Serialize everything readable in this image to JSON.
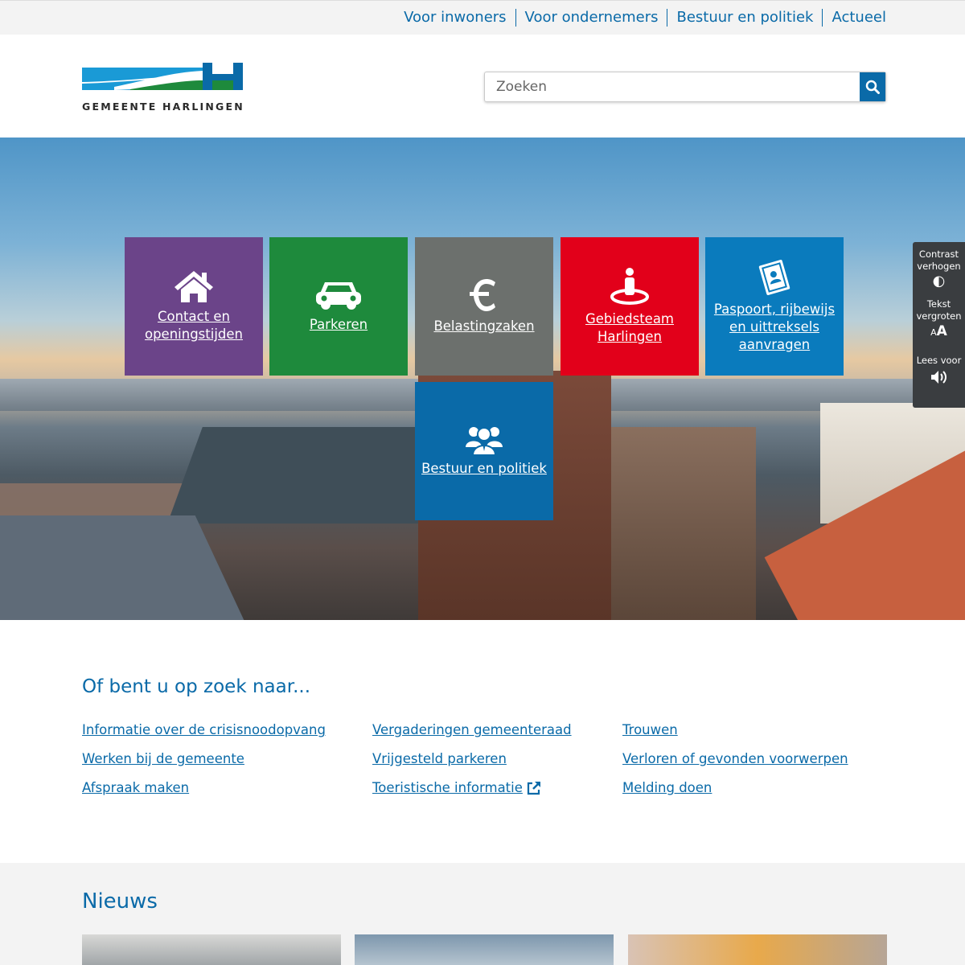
{
  "topnav": [
    "Voor inwoners",
    "Voor ondernemers",
    "Bestuur en politiek",
    "Actueel"
  ],
  "logo": {
    "text": "GEMEENTE HARLINGEN"
  },
  "search": {
    "placeholder": "Zoeken"
  },
  "colors": {
    "brand_blue": "#0a6aa8",
    "purple": "#6b4489",
    "green": "#1e8a3c",
    "grey": "#6c706d",
    "red": "#e2001a",
    "light_blue": "#0a7bbd"
  },
  "tiles": [
    {
      "label": "Contact en openingstijden",
      "icon": "home-icon"
    },
    {
      "label": "Parkeren",
      "icon": "car-icon"
    },
    {
      "label": "Belastingzaken",
      "icon": "euro-icon"
    },
    {
      "label": "Gebiedsteam Harlingen",
      "icon": "person-location-icon"
    },
    {
      "label": "Paspoort, rijbewijs en uittreksels aanvragen",
      "icon": "passport-icon"
    },
    {
      "label": "Bestuur en politiek",
      "icon": "people-icon"
    }
  ],
  "a11y": {
    "contrast": "Contrast verhogen",
    "text": "Tekst vergroten",
    "read": "Lees voor"
  },
  "zoek": {
    "title": "Of bent u op zoek naar...",
    "col1": [
      "Informatie over de crisisnoodopvang",
      "Werken bij de gemeente",
      "Afspraak maken"
    ],
    "col2": [
      "Vergaderingen gemeenteraad",
      "Vrijgesteld parkeren",
      "Toeristische informatie"
    ],
    "col3": [
      "Trouwen",
      "Verloren of gevonden voorwerpen",
      "Melding doen"
    ]
  },
  "news": {
    "title": "Nieuws"
  }
}
